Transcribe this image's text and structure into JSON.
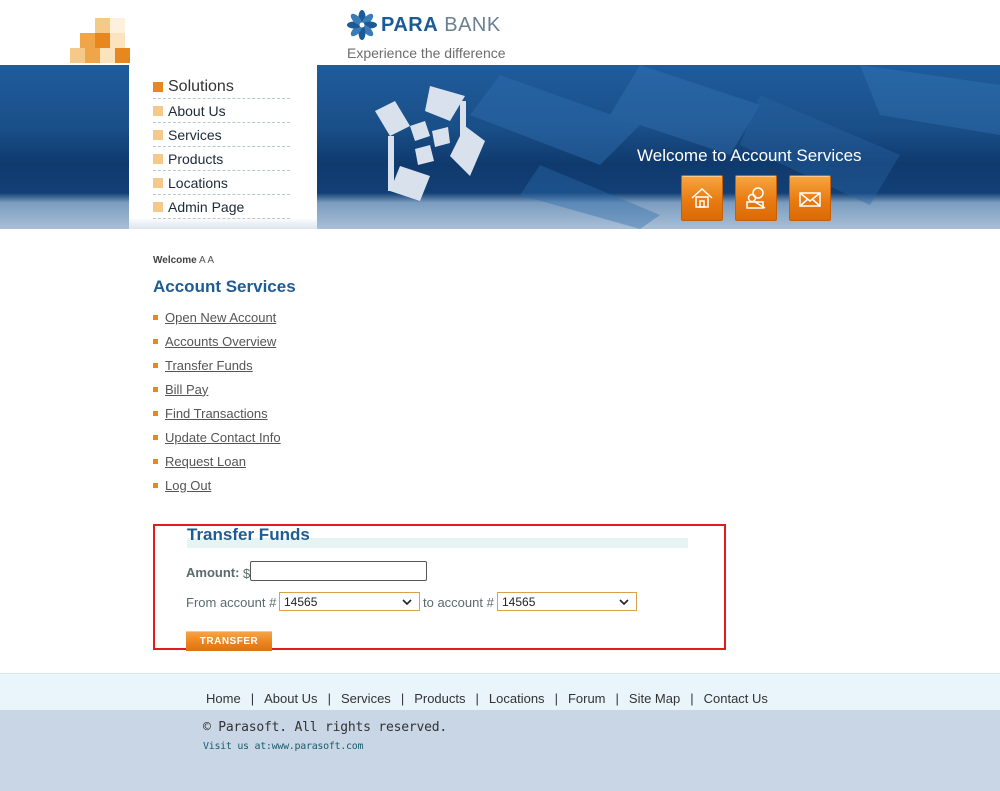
{
  "brand": {
    "name_part1": "PARA",
    "name_part2": "BANK",
    "tagline": "Experience the difference"
  },
  "banner": {
    "title": "Welcome to Account Services",
    "buttons": [
      {
        "icon": "home-icon"
      },
      {
        "icon": "about-icon"
      },
      {
        "icon": "contact-icon"
      }
    ]
  },
  "main_menu": [
    {
      "label": "Solutions"
    },
    {
      "label": "About Us"
    },
    {
      "label": "Services"
    },
    {
      "label": "Products"
    },
    {
      "label": "Locations"
    },
    {
      "label": "Admin Page"
    }
  ],
  "account": {
    "welcome_label": "Welcome",
    "user_name": "A A",
    "title": "Account Services",
    "links": [
      {
        "label": "Open New Account"
      },
      {
        "label": "Accounts Overview"
      },
      {
        "label": "Transfer Funds"
      },
      {
        "label": "Bill Pay"
      },
      {
        "label": "Find Transactions"
      },
      {
        "label": "Update Contact Info"
      },
      {
        "label": "Request Loan"
      },
      {
        "label": "Log Out"
      }
    ]
  },
  "transfer": {
    "title": "Transfer Funds",
    "amount_label": "Amount:",
    "currency": "$",
    "amount_value": "",
    "from_label": "From account #",
    "from_value": "14565",
    "to_label": "to account #",
    "to_value": "14565",
    "button_label": "TRANSFER",
    "highlight_color": "#e21b1b"
  },
  "footer": {
    "links": [
      "Home",
      "About Us",
      "Services",
      "Products",
      "Locations",
      "Forum",
      "Site Map",
      "Contact Us"
    ],
    "separator": "|",
    "copyright": "© Parasoft. All rights reserved.",
    "visit": "Visit us at:www.parasoft.com"
  },
  "colors": {
    "brand_blue": "#1f5c94",
    "accent_orange": "#e8871e",
    "banner_blue": "#1a4f88"
  }
}
